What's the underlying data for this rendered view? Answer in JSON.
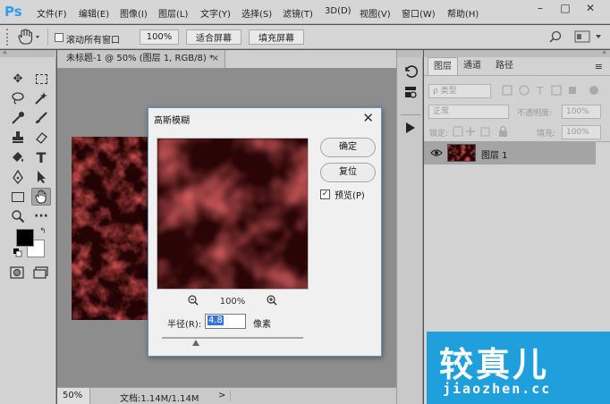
{
  "app": {
    "logo": "Ps"
  },
  "menu": [
    "文件(F)",
    "编辑(E)",
    "图像(I)",
    "图层(L)",
    "文字(Y)",
    "选择(S)",
    "滤镜(T)",
    "3D(D)",
    "视图(V)",
    "窗口(W)",
    "帮助(H)"
  ],
  "window_controls": {
    "minimize": "–",
    "maximize": "□",
    "close": "✕"
  },
  "options": {
    "scroll_all_label": "滚动所有窗口",
    "zoom_btn": "100%",
    "fit_btn": "适合屏幕",
    "fill_btn": "填充屏幕",
    "scroll_all_checked": false
  },
  "document": {
    "tab_title": "未标题-1 @ 50% (图层 1, RGB/8) *",
    "close": "×",
    "zoom": "50%",
    "doc_info": "文档:1.14M/1.14M",
    "arrow": ">"
  },
  "layers_panel": {
    "tabs": [
      "图层",
      "通道",
      "路径"
    ],
    "active_tab": "图层",
    "kind_filter": "ρ 类型",
    "blend_mode": "正常",
    "opacity_label": "不透明度:",
    "opacity_value": "100%",
    "lock_label": "锁定:",
    "fill_label": "填充:",
    "fill_value": "100%",
    "layer_name": "图层 1"
  },
  "dialog": {
    "title": "高斯模糊",
    "close": "✕",
    "ok": "确定",
    "reset": "复位",
    "preview_label": "预览(P)",
    "preview_checked": true,
    "zoom_level": "100%",
    "radius_label": "半径(R):",
    "radius_value": "4.8",
    "radius_unit": "像素",
    "radius_slider_fraction": 0.24
  },
  "watermark": {
    "main": "较真儿",
    "url": "jiaozhen.cc"
  },
  "colors": {
    "accent": "#1f9fdb",
    "ps_blue": "#2f9cf4",
    "dialog_border": "#5b8fc8",
    "texture_red": "#b01e1e"
  }
}
